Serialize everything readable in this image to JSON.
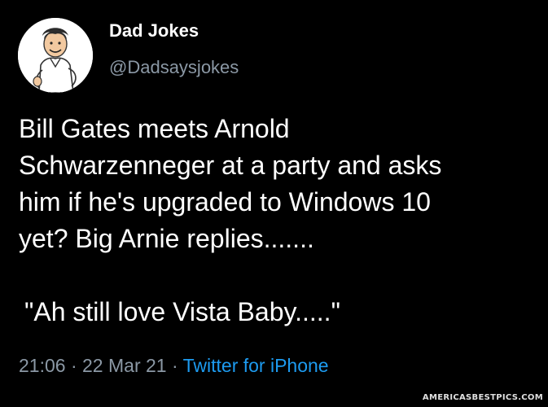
{
  "account": {
    "display_name": "Dad Jokes",
    "handle": "@Dadsaysjokes",
    "avatar_icon": "cartoon-man-avatar-icon"
  },
  "tweet": {
    "lines": [
      "Bill Gates meets Arnold",
      "Schwarzenneger at a party and asks",
      "him if he's upgraded to Windows 10",
      "yet? Big Arnie replies.......",
      "\"Ah still love Vista Baby.....\""
    ]
  },
  "meta": {
    "time": "21:06",
    "separator": "·",
    "date": "22 Mar 21",
    "source": "Twitter for iPhone"
  },
  "watermark": "AMERICASBESTPICS.COM",
  "colors": {
    "background": "#000000",
    "text": "#ffffff",
    "muted": "#8b98a5",
    "link": "#1d9bf0"
  }
}
